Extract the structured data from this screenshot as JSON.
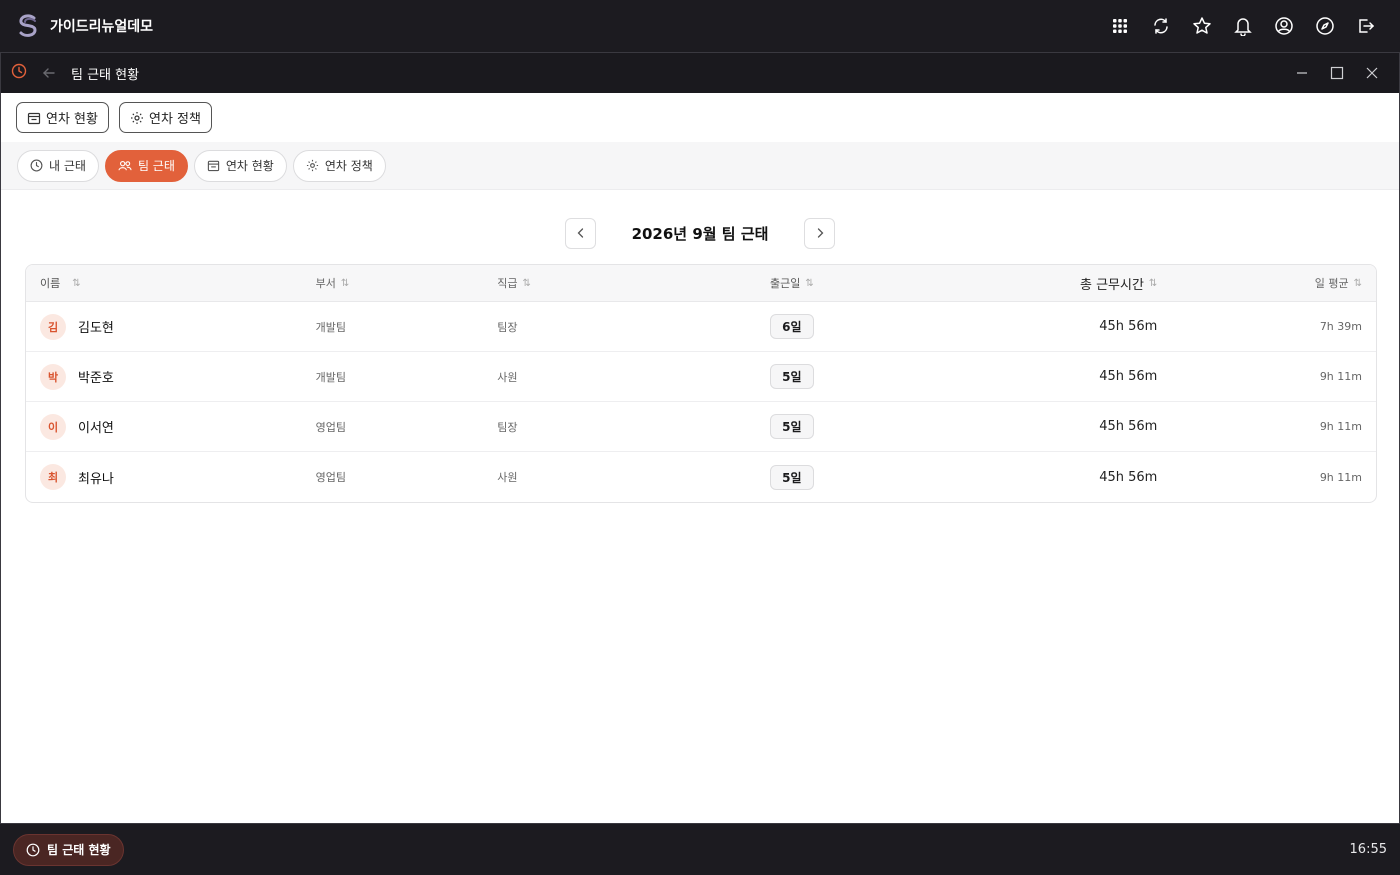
{
  "app": {
    "name": "가이드리뉴얼데모"
  },
  "top_icons": [
    "apps-grid-icon",
    "sync-icon",
    "star-icon",
    "bell-icon",
    "user-icon",
    "compass-icon",
    "logout-icon"
  ],
  "window": {
    "title": "팀 근태 현황"
  },
  "toolbar": {
    "leave_status_label": "연차 현황",
    "leave_policy_label": "연차 정책"
  },
  "tabs": [
    {
      "label": "내 근태",
      "icon": "clock-icon",
      "active": false
    },
    {
      "label": "팀 근태",
      "icon": "users-icon",
      "active": true
    },
    {
      "label": "연차 현황",
      "icon": "calendar-icon",
      "active": false
    },
    {
      "label": "연차 정책",
      "icon": "gear-icon",
      "active": false
    }
  ],
  "month_nav": {
    "title": "2026년 9월 팀 근태"
  },
  "table": {
    "headers": {
      "name": "이름",
      "dept": "부서",
      "position": "직급",
      "days": "출근일",
      "total": "총 근무시간",
      "avg": "일 평균"
    },
    "rows": [
      {
        "initial": "김",
        "name": "김도현",
        "dept": "개발팀",
        "position": "팀장",
        "days": "6일",
        "total": "45h 56m",
        "avg": "7h 39m"
      },
      {
        "initial": "박",
        "name": "박준호",
        "dept": "개발팀",
        "position": "사원",
        "days": "5일",
        "total": "45h 56m",
        "avg": "9h 11m"
      },
      {
        "initial": "이",
        "name": "이서연",
        "dept": "영업팀",
        "position": "팀장",
        "days": "5일",
        "total": "45h 56m",
        "avg": "9h 11m"
      },
      {
        "initial": "최",
        "name": "최유나",
        "dept": "영업팀",
        "position": "사원",
        "days": "5일",
        "total": "45h 56m",
        "avg": "9h 11m"
      }
    ]
  },
  "taskbar": {
    "item_label": "팀 근태 현황",
    "clock": "16:55"
  },
  "colors": {
    "accent": "#e2613b",
    "avatar_bg": "#fbe8e1",
    "avatar_fg": "#d9542f"
  }
}
